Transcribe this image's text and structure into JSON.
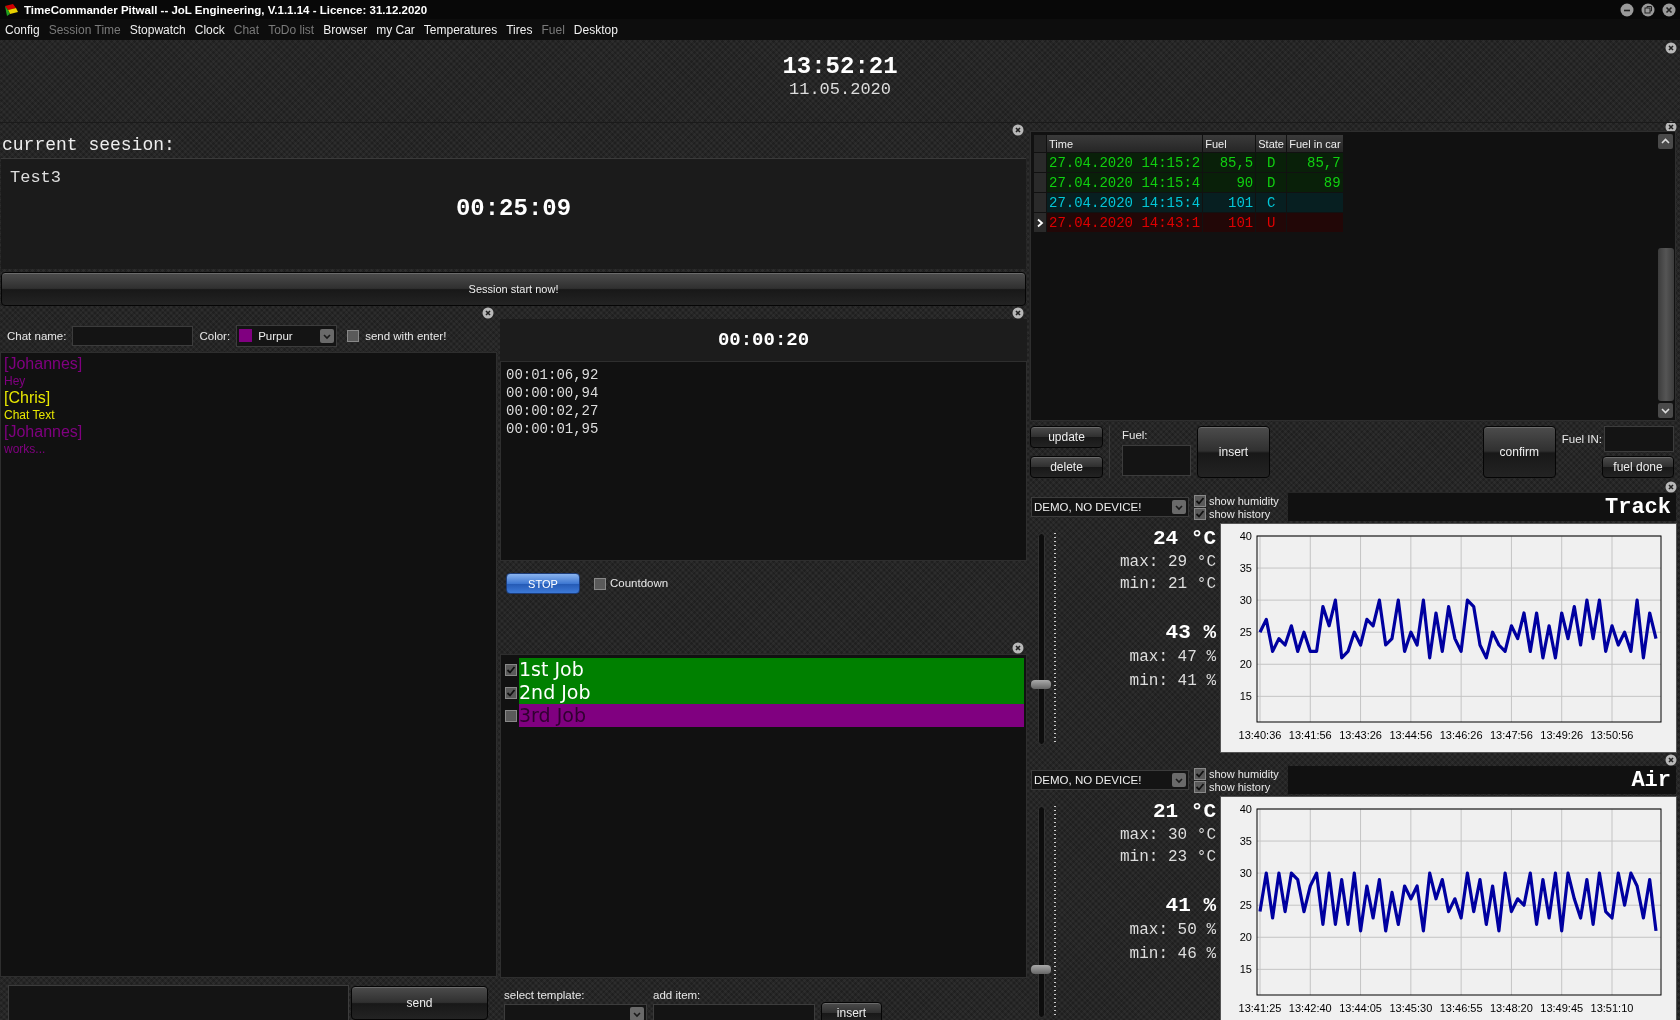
{
  "window": {
    "title": "TimeCommander Pitwall -- JoL Engineering, V.1.1.14 - Licence: 31.12.2020"
  },
  "menu": [
    {
      "label": "Config",
      "disabled": false
    },
    {
      "label": "Session Time",
      "disabled": true
    },
    {
      "label": "Stopwatch",
      "disabled": false
    },
    {
      "label": "Clock",
      "disabled": false
    },
    {
      "label": "Chat",
      "disabled": true
    },
    {
      "label": "ToDo list",
      "disabled": true
    },
    {
      "label": "Browser",
      "disabled": false
    },
    {
      "label": "my Car",
      "disabled": false
    },
    {
      "label": "Temperatures",
      "disabled": false
    },
    {
      "label": "Tires",
      "disabled": false
    },
    {
      "label": "Fuel",
      "disabled": true
    },
    {
      "label": "Desktop",
      "disabled": false
    }
  ],
  "clock": {
    "time": "13:52:21",
    "date": "11.05.2020"
  },
  "session": {
    "label": "current seesion:",
    "name": "Test3",
    "elapsed": "00:25:09",
    "button": "Session start now!"
  },
  "chat": {
    "name_label": "Chat name:",
    "color_label": "Color:",
    "color_choice": {
      "label": "Purpur",
      "color": "#800080"
    },
    "send_with_enter": {
      "label": "send with enter!",
      "checked": false
    },
    "messages": [
      {
        "author": "[Johannes]",
        "text": "Hey",
        "color": "#800080"
      },
      {
        "author": "[Chris]",
        "text": "Chat Text",
        "color": "#e8e800"
      },
      {
        "author": "[Johannes]",
        "text": "works...",
        "color": "#800080"
      }
    ],
    "send_button": "send"
  },
  "stopwatch": {
    "time": "00:00:20",
    "laps": [
      "00:01:06,92",
      "00:00:00,94",
      "00:00:02,27",
      "00:00:01,95"
    ],
    "stop_button": "STOP",
    "countdown": {
      "label": "Countdown",
      "checked": false
    }
  },
  "todo": {
    "items": [
      {
        "label": "1st Job",
        "checked": true,
        "color": "#008000"
      },
      {
        "label": "2nd Job",
        "checked": true,
        "color": "#008000"
      },
      {
        "label": "3rd Job",
        "checked": false,
        "color": "#800080"
      }
    ],
    "template_label": "select template:",
    "add_label": "add item:",
    "insert_button": "insert"
  },
  "fuel": {
    "columns": [
      "Time",
      "Fuel",
      "State",
      "Fuel in car"
    ],
    "rows": [
      {
        "time": "27.04.2020 14:15:2",
        "fuel": "85,5",
        "state": "D",
        "fuel_in_car": "85,7",
        "color": "#10d010",
        "selected": false
      },
      {
        "time": "27.04.2020 14:15:4",
        "fuel": "90",
        "state": "D",
        "fuel_in_car": "89",
        "color": "#10d010",
        "selected": false
      },
      {
        "time": "27.04.2020 14:15:4",
        "fuel": "101",
        "state": "C",
        "color": "#00c8d8",
        "selected": false
      },
      {
        "time": "27.04.2020 14:43:1",
        "fuel": "101",
        "state": "U",
        "color": "#e00000",
        "selected": true
      }
    ],
    "update_button": "update",
    "delete_button": "delete",
    "fuel_label": "Fuel:",
    "insert_button": "insert",
    "confirm_button": "confirm",
    "fuel_in_label": "Fuel IN:",
    "fuel_done_button": "fuel done"
  },
  "sensors": [
    {
      "device": "DEMO, NO DEVICE!",
      "show_humidity": {
        "label": "show humidity",
        "checked": true
      },
      "show_history": {
        "label": "show history",
        "checked": true
      },
      "title": "Track",
      "temperature": "24 °C",
      "temp_max": "max: 29 °C",
      "temp_min": "min: 21 °C",
      "humidity": "43 %",
      "hum_max": "max: 47 %",
      "hum_min": "min: 41 %",
      "level": 0.29,
      "chart_data": {
        "type": "line",
        "grid": true,
        "ylim": [
          11,
          40
        ],
        "yticks": [
          15,
          20,
          25,
          30,
          35,
          40
        ],
        "categories": [
          "13:40:36",
          null,
          null,
          null,
          null,
          null,
          null,
          null,
          "13:41:56",
          null,
          null,
          null,
          null,
          null,
          null,
          null,
          "13:43:26",
          null,
          null,
          null,
          null,
          null,
          null,
          null,
          "13:44:56",
          null,
          null,
          null,
          null,
          null,
          null,
          null,
          "13:46:26",
          null,
          null,
          null,
          null,
          null,
          null,
          null,
          "13:47:56",
          null,
          null,
          null,
          null,
          null,
          null,
          null,
          "13:49:26",
          null,
          null,
          null,
          null,
          null,
          null,
          null,
          "13:50:56",
          null,
          null,
          null,
          null,
          null,
          null,
          null
        ],
        "series": [
          {
            "color": "#0000a0",
            "values": [
              25,
              27,
              22,
              24,
              23,
              26,
              22,
              25,
              22,
              22,
              29,
              26,
              30,
              21,
              22,
              25,
              23,
              27,
              26,
              30,
              23,
              24,
              30,
              22,
              25,
              23,
              30,
              21,
              28,
              22,
              29,
              24,
              22,
              30,
              29,
              23,
              21,
              25,
              23,
              22,
              26,
              24,
              28,
              22,
              28,
              21,
              26,
              21,
              28,
              24,
              29,
              23,
              30,
              24,
              30,
              22,
              26,
              23,
              25,
              22,
              30,
              21,
              28,
              24
            ]
          }
        ]
      }
    },
    {
      "device": "DEMO, NO DEVICE!",
      "show_humidity": {
        "label": "show humidity",
        "checked": true
      },
      "show_history": {
        "label": "show history",
        "checked": true
      },
      "title": "Air",
      "temperature": "21 °C",
      "temp_max": "max: 30 °C",
      "temp_min": "min: 23 °C",
      "humidity": "41 %",
      "hum_max": "max: 50 %",
      "hum_min": "min: 46 %",
      "level": 0.23,
      "chart_data": {
        "type": "line",
        "grid": true,
        "ylim": [
          11,
          40
        ],
        "yticks": [
          15,
          20,
          25,
          30,
          35,
          40
        ],
        "categories": [
          "13:41:25",
          null,
          null,
          null,
          null,
          null,
          null,
          null,
          "13:42:40",
          null,
          null,
          null,
          null,
          null,
          null,
          null,
          "13:44:05",
          null,
          null,
          null,
          null,
          null,
          null,
          null,
          "13:45:30",
          null,
          null,
          null,
          null,
          null,
          null,
          null,
          "13:46:55",
          null,
          null,
          null,
          null,
          null,
          null,
          null,
          "13:48:20",
          null,
          null,
          null,
          null,
          null,
          null,
          null,
          "13:49:45",
          null,
          null,
          null,
          null,
          null,
          null,
          null,
          "13:51:10",
          null,
          null,
          null,
          null,
          null,
          null,
          null
        ],
        "series": [
          {
            "color": "#0000a0",
            "values": [
              24,
              30,
              23,
              30,
              24,
              30,
              29,
              24,
              28,
              30,
              22,
              30,
              22,
              29,
              22,
              30,
              21,
              28,
              23,
              29,
              21,
              27,
              22,
              28,
              26,
              28,
              21,
              30,
              26,
              29,
              24,
              26,
              23,
              30,
              24,
              29,
              22,
              28,
              21,
              30,
              24,
              26,
              25,
              30,
              22,
              29,
              23,
              30,
              21,
              30,
              26,
              23,
              29,
              22,
              30,
              24,
              23,
              30,
              25,
              30,
              28,
              23,
              29,
              21
            ]
          }
        ]
      }
    }
  ]
}
